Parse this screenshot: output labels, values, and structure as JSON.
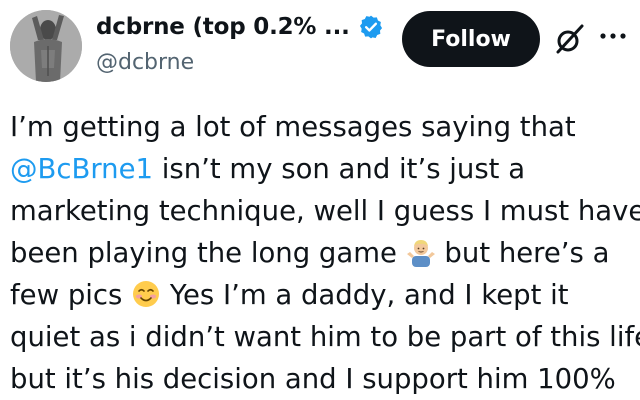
{
  "author": {
    "display_name": "dcbrne (top 0.2% ...",
    "handle": "@dcbrne",
    "verified": true,
    "avatar_icon": "profile-photo"
  },
  "actions": {
    "follow_label": "Follow",
    "grok_icon": "grok-icon",
    "more_icon": "more-icon"
  },
  "tweet": {
    "line1": "I’m getting a lot of messages saying that",
    "line2_mention": "@BcBrne1",
    "line2_rest": " isn’t my son and it’s just a",
    "line3": "marketing technique, well I guess I must have",
    "line4_a": "been playing the long game ",
    "line4_emoji": "man-shrugging-emoji",
    "line4_b": " but here’s a",
    "line5_a": "few pics ",
    "line5_emoji": "smiling-face-emoji",
    "line5_b": " Yes I’m a daddy, and I kept it",
    "line6": "quiet as i didn’t want him to be part of this life",
    "line7": "but it’s his decision and I support him 100%"
  },
  "colors": {
    "text": "#0f1419",
    "secondary": "#536471",
    "link": "#1d9bf0",
    "verified": "#1d9bf0",
    "button_bg": "#0f1419",
    "button_text": "#ffffff"
  }
}
